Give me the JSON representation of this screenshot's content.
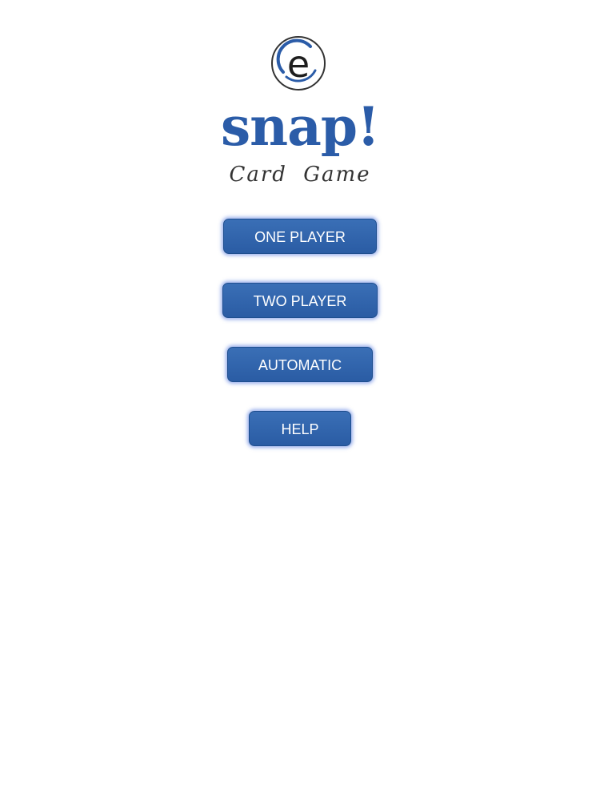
{
  "logo": {
    "icon": "e-logo-icon",
    "letter": "e"
  },
  "title": "snap!",
  "subtitle": "Card Game",
  "menu": {
    "one_player": "ONE PLAYER",
    "two_player": "TWO PLAYER",
    "automatic": "AUTOMATIC",
    "help": "HELP"
  },
  "colors": {
    "brand_blue": "#2b5ca8",
    "button_fill": "#2f62aa",
    "background": "#ffffff"
  }
}
